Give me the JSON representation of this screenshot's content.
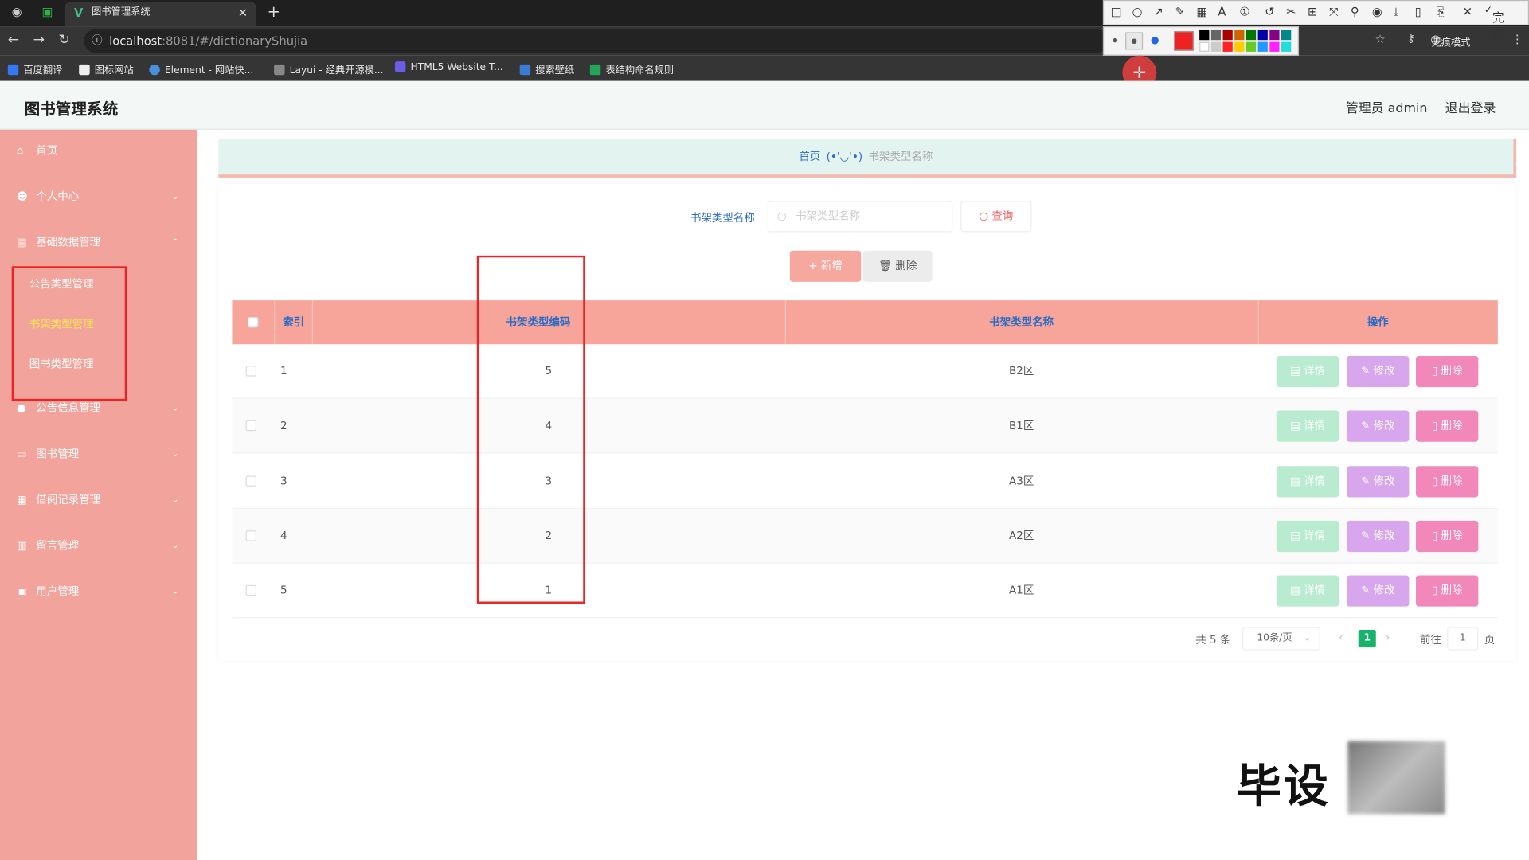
{
  "browser": {
    "tab_title": "图书管理系统",
    "url_host": "localhost",
    "url_path": ":8081/#/dictionaryShujia",
    "incognito_label": "无痕模式",
    "bookmarks": [
      "百度翻译",
      "图标网站",
      "Element - 网站快...",
      "Layui - 经典开源模...",
      "HTML5 Website T...",
      "搜索壁纸",
      "表结构命名规则"
    ],
    "tool_done": "完成"
  },
  "header": {
    "title": "图书管理系统",
    "admin": "管理员 admin",
    "logout": "退出登录"
  },
  "sidebar": {
    "items": [
      {
        "label": "首页"
      },
      {
        "label": "个人中心"
      },
      {
        "label": "基础数据管理"
      },
      {
        "label": "公告信息管理"
      },
      {
        "label": "图书管理"
      },
      {
        "label": "借阅记录管理"
      },
      {
        "label": "留言管理"
      },
      {
        "label": "用户管理"
      }
    ],
    "subitems": [
      {
        "label": "公告类型管理"
      },
      {
        "label": "书架类型管理"
      },
      {
        "label": "图书类型管理"
      }
    ]
  },
  "breadcrumb": {
    "home": "首页",
    "face": "(•'◡'•)",
    "current": "书架类型名称"
  },
  "search": {
    "label": "书架类型名称",
    "placeholder": "书架类型名称",
    "query": "查询"
  },
  "actions": {
    "add": "新增",
    "delete": "删除"
  },
  "table": {
    "headers": [
      "索引",
      "书架类型编码",
      "书架类型名称",
      "操作"
    ],
    "rows": [
      {
        "index": "1",
        "code": "5",
        "name": "B2区"
      },
      {
        "index": "2",
        "code": "4",
        "name": "B1区"
      },
      {
        "index": "3",
        "code": "3",
        "name": "A3区"
      },
      {
        "index": "4",
        "code": "2",
        "name": "A2区"
      },
      {
        "index": "5",
        "code": "1",
        "name": "A1区"
      }
    ],
    "op_detail": "详情",
    "op_edit": "修改",
    "op_delete": "删除"
  },
  "pagination": {
    "total": "共 5 条",
    "page_size": "10条/页",
    "current": "1",
    "goto_label": "前往",
    "goto_value": "1",
    "page_suffix": "页"
  },
  "watermark": "毕设",
  "colors": {
    "sidebar": "#f2a39b",
    "table_header": "#f7a49a",
    "accent_text": "#2a6cc5",
    "pagination_active": "#18b36b"
  }
}
